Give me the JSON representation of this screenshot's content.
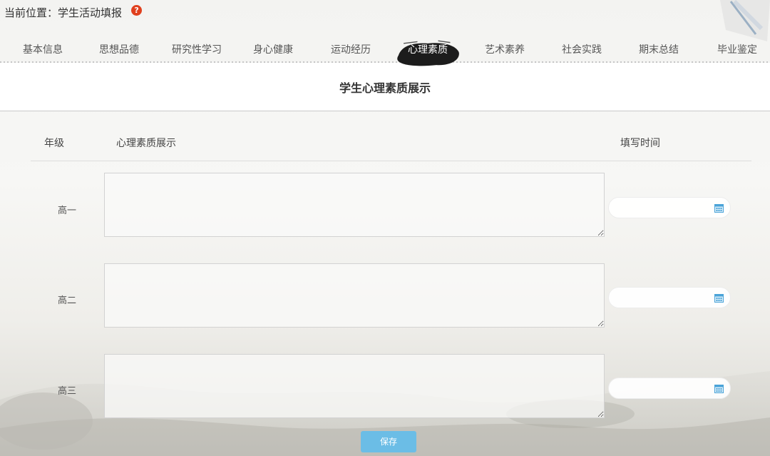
{
  "location": {
    "label": "当前位置：",
    "path": "学生活动填报"
  },
  "tabs": [
    {
      "label": "基本信息",
      "active": false
    },
    {
      "label": "思想品德",
      "active": false
    },
    {
      "label": "研究性学习",
      "active": false
    },
    {
      "label": "身心健康",
      "active": false
    },
    {
      "label": "运动经历",
      "active": false
    },
    {
      "label": "心理素质",
      "active": true
    },
    {
      "label": "艺术素养",
      "active": false
    },
    {
      "label": "社会实践",
      "active": false
    },
    {
      "label": "期末总结",
      "active": false
    },
    {
      "label": "毕业鉴定",
      "active": false
    }
  ],
  "section_title": "学生心理素质展示",
  "table": {
    "headers": {
      "grade": "年级",
      "display": "心理素质展示",
      "time": "填写时间"
    },
    "rows": [
      {
        "grade": "高一",
        "content": "",
        "date": ""
      },
      {
        "grade": "高二",
        "content": "",
        "date": ""
      },
      {
        "grade": "高三",
        "content": "",
        "date": ""
      }
    ]
  },
  "save_label": "保存",
  "icons": {
    "help": "help-icon",
    "calendar": "calendar-icon"
  },
  "colors": {
    "accent": "#6bbde6",
    "help": "#e0401e",
    "calendar": "#4aa3d8"
  }
}
